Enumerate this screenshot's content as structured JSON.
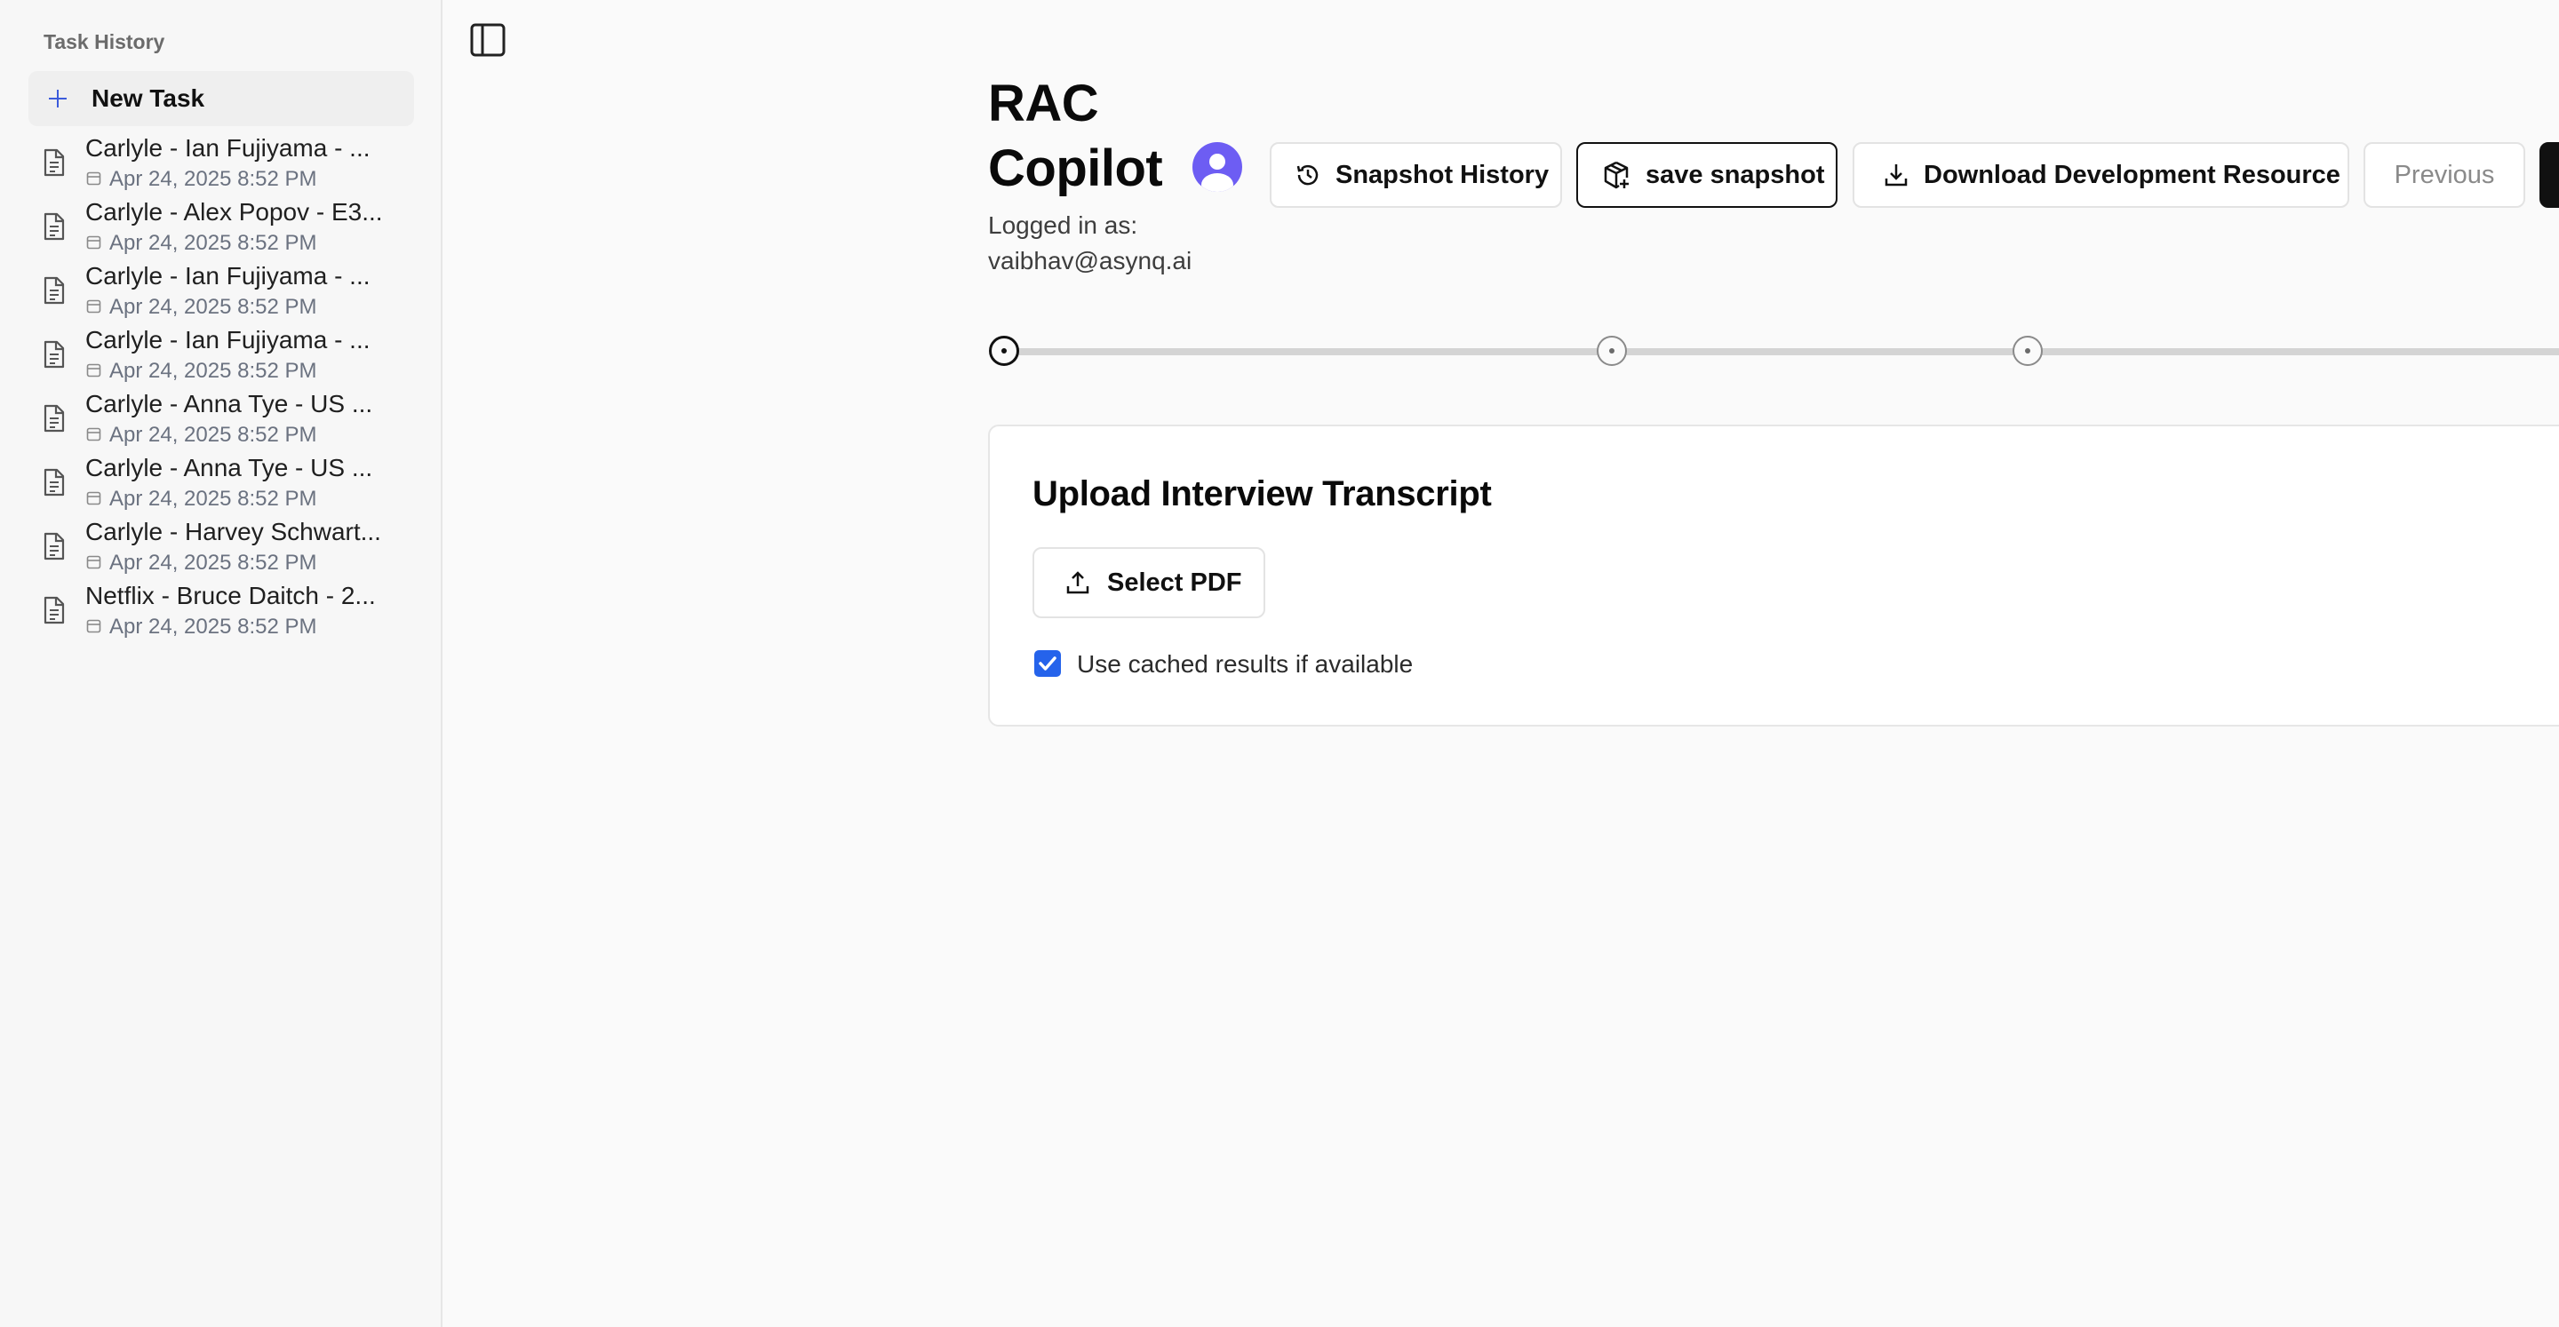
{
  "sidebar": {
    "title": "Task History",
    "new_task_label": "New Task",
    "tasks": [
      {
        "name": "Carlyle - Ian Fujiyama - ...",
        "date": "Apr 24, 2025 8:52 PM"
      },
      {
        "name": "Carlyle - Alex Popov - E3...",
        "date": "Apr 24, 2025 8:52 PM"
      },
      {
        "name": "Carlyle - Ian Fujiyama - ...",
        "date": "Apr 24, 2025 8:52 PM"
      },
      {
        "name": "Carlyle - Ian Fujiyama - ...",
        "date": "Apr 24, 2025 8:52 PM"
      },
      {
        "name": "Carlyle - Anna Tye - US ...",
        "date": "Apr 24, 2025 8:52 PM"
      },
      {
        "name": "Carlyle - Anna Tye - US ...",
        "date": "Apr 24, 2025 8:52 PM"
      },
      {
        "name": "Carlyle - Harvey Schwart...",
        "date": "Apr 24, 2025 8:52 PM"
      },
      {
        "name": "Netflix - Bruce Daitch - 2...",
        "date": "Apr 24, 2025 8:52 PM"
      }
    ]
  },
  "header": {
    "title": "RAC Copilot",
    "logged_in_label": "Logged in as:",
    "user_email": "vaibhav@asynq.ai"
  },
  "toolbar": {
    "snapshot_history_label": "Snapshot History",
    "save_snapshot_label": "save snapshot",
    "download_label": "Download Development Resource",
    "previous_label": "Previous"
  },
  "stepper": {
    "current_step": 1
  },
  "upload_card": {
    "title": "Upload Interview Transcript",
    "select_pdf_label": "Select PDF",
    "cached_label": "Use cached results if available",
    "cached_checked": true
  },
  "colors": {
    "accent_blue": "#2563eb",
    "avatar_purple": "#6d5df3"
  }
}
